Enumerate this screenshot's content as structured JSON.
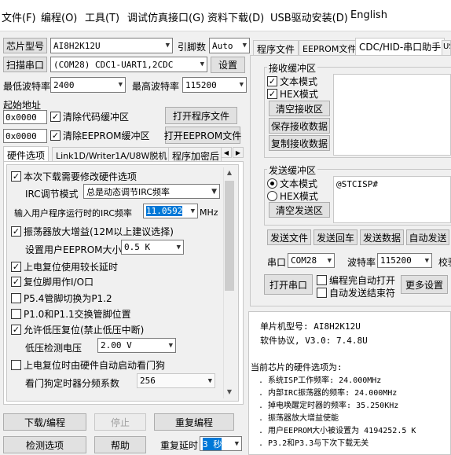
{
  "menu": [
    "文件(F)",
    "编程(O)",
    "工具(T)",
    "调试仿真接口(G)",
    "资料下载(D)",
    "USB驱动安装(D)",
    "English"
  ],
  "left": {
    "chip_btn": "芯片型号",
    "chip_value": "AI8H2K12U",
    "pins_label": "引脚数",
    "pins_value": "Auto",
    "scan_btn": "扫描串口",
    "port_value": "(COM28) CDC1-UART1,2CDC",
    "settings_btn": "设置",
    "min_baud_label": "最低波特率",
    "min_baud_value": "2400",
    "max_baud_label": "最高波特率",
    "max_baud_value": "115200",
    "start_addr_label": "起始地址",
    "code_addr": "0x0000",
    "clear_code": "清除代码缓冲区",
    "open_prog": "打开程序文件",
    "eep_addr": "0x0000",
    "clear_eep": "清除EEPROM缓冲区",
    "open_eep": "打开EEPROM文件",
    "tabs": [
      "硬件选项",
      "Link1D/Writer1A/U8W脱机",
      "程序加密后"
    ],
    "hw": {
      "need_modify": "本次下载需要修改硬件选项",
      "irc_mode_label": "IRC调节模式",
      "irc_mode_value": "总是动态调节IRC频率",
      "irc_freq_label": "输入用户程序运行时的IRC频率",
      "irc_freq_value": "11.0592",
      "irc_unit": "MHz",
      "osc_gain": "振荡器放大增益(12M以上建议选择)",
      "eep_size_label": "设置用户EEPROM大小",
      "eep_size_value": "0.5 K",
      "power_reset": "上电复位使用较长延时",
      "reset_io": "复位脚用作I/O口",
      "p54": "P5.4管脚切换为P1.2",
      "p10": "P1.0和P1.1交换管脚位置",
      "lvr": "允许低压复位(禁止低压中断)",
      "lvd_label": "低压检测电压",
      "lvd_value": "2.00 V",
      "wdt_auto": "上电复位时由硬件自动启动看门狗",
      "wdt_div_label": "看门狗定时器分频系数",
      "wdt_div_value": "256"
    },
    "download_btn": "下载/编程",
    "stop_btn": "停止",
    "reprog_btn": "重复编程",
    "detect_btn": "检测选项",
    "help_btn": "帮助",
    "delay_label": "重复延时",
    "delay_value": "3 秒"
  },
  "right": {
    "tabs": [
      "程序文件",
      "EEPROM文件",
      "CDC/HID-串口助手",
      "US"
    ],
    "recv_title": "接收缓冲区",
    "recv_text": "文本模式",
    "recv_hex": "HEX模式",
    "clear_recv": "清空接收区",
    "save_recv": "保存接收数据",
    "copy_recv": "复制接收数据",
    "send_title": "发送缓冲区",
    "send_text": "文本模式",
    "send_hex": "HEX模式",
    "clear_send": "清空发送区",
    "send_content": "@STCISP#",
    "send_file": "发送文件",
    "send_enter": "发送回车",
    "send_data": "发送数据",
    "auto_send": "自动发送",
    "port_label": "串口",
    "port_value": "COM28",
    "baud_label": "波特率",
    "baud_value": "115200",
    "check_label": "校验",
    "open_port": "打开串口",
    "auto_open": "编程完自动打开",
    "auto_clear": "自动发送结束符",
    "more": "更多设置"
  },
  "output": {
    "lines": [
      "单片机型号: AI8H2K12U",
      "软件协议, V3.0: 7.4.8U",
      "",
      "当前芯片的硬件选项为:",
      ". 系统ISP工作频率: 24.000MHz",
      ". 内部IRC振荡器的频率: 24.000MHz",
      ". 掉电唤醒定时器的频率: 35.250KHz",
      ". 振荡器放大增益使能",
      ". 用户EEPROM大小被设置为 4194252.5 K",
      ". P3.2和P3.3与下次下载无关"
    ]
  }
}
